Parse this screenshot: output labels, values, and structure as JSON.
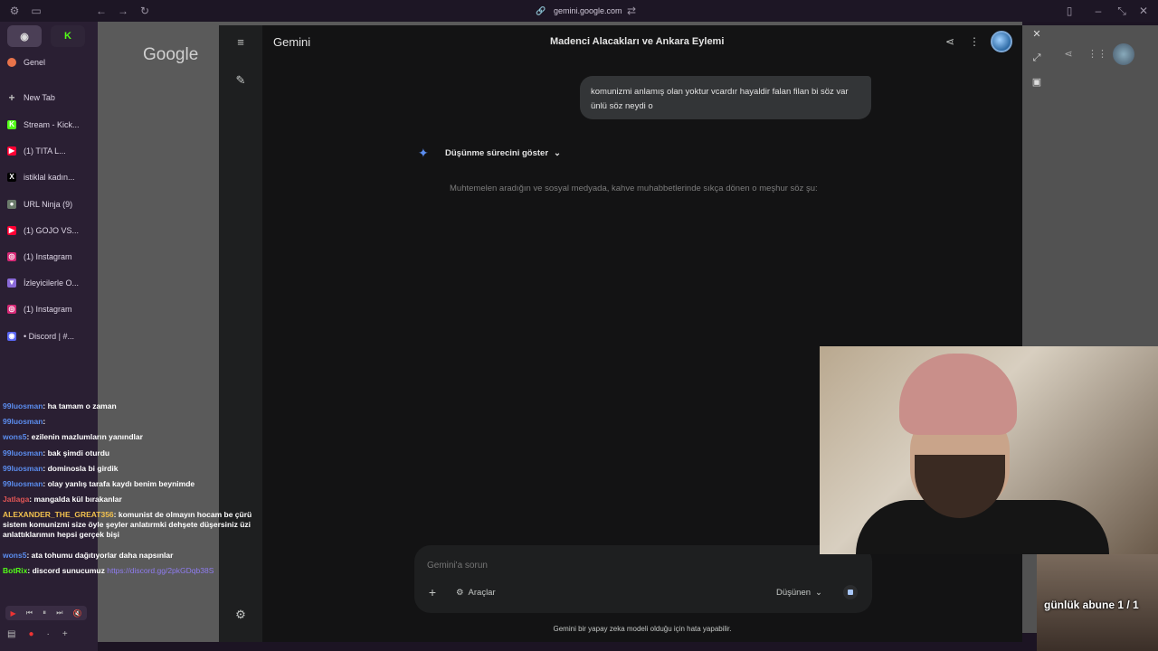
{
  "browser": {
    "url": "gemini.google.com"
  },
  "vertical_tabs": {
    "section_label": "Genel",
    "new_tab_label": "New Tab",
    "tabs": [
      {
        "label": "Stream - Kick...",
        "color": "#53fc18",
        "glyph": "K"
      },
      {
        "label": "(1) TITA L...",
        "color": "#ff0033",
        "glyph": "▶"
      },
      {
        "label": "istiklal kadın...",
        "color": "#000000",
        "glyph": "X"
      },
      {
        "label": "URL Ninja (9)",
        "color": "#6b7b6b",
        "glyph": "●"
      },
      {
        "label": "(1) GOJO VS...",
        "color": "#ff0033",
        "glyph": "▶"
      },
      {
        "label": "(1) Instagram",
        "color": "#d62976",
        "glyph": "◎"
      },
      {
        "label": "İzleyicilerle O...",
        "color": "#8a6ad8",
        "glyph": "▼"
      },
      {
        "label": "(1) Instagram",
        "color": "#d62976",
        "glyph": "◎"
      },
      {
        "label": "• Discord | #...",
        "color": "#5865f2",
        "glyph": "◉"
      }
    ]
  },
  "chat": {
    "messages": [
      {
        "user": "99luosman",
        "user_color": "#5b8def",
        "text": ": ha tamam o zaman"
      },
      {
        "user": "99luosman",
        "user_color": "#5b8def",
        "text": ": "
      },
      {
        "user": "wons5",
        "user_color": "#5b8def",
        "text": ": ezilenin mazlumların yanındlar"
      },
      {
        "user": "99luosman",
        "user_color": "#5b8def",
        "text": ": bak şimdi oturdu"
      },
      {
        "user": "99luosman",
        "user_color": "#5b8def",
        "text": ": dominosla bi girdik"
      },
      {
        "user": "99luosman",
        "user_color": "#5b8def",
        "text": ": olay yanlış tarafa kaydı benim beynimde"
      },
      {
        "user": "Jatlaga",
        "user_color": "#e05555",
        "text": ": mangalda kül bırakanlar"
      },
      {
        "user": "ALEXANDER_THE_GREAT356",
        "user_color": "#f2c14e",
        "text": ": komunist de olmayın hocam be çürü sistem komunizmi size öyle şeyler anlatırmki dehşete düşersiniz üzi anlattıklarımın hepsi gerçek bişi"
      },
      {
        "user": "wons5",
        "user_color": "#5b8def",
        "text": ": ata tohumu dağıtıyorlar daha napsınlar"
      },
      {
        "user": "BotRix",
        "user_color": "#53fc18",
        "text": ": discord sunucumuz ",
        "link": "https://discord.gg/2pkGDqb38S"
      }
    ]
  },
  "google_page": {
    "logo": "Google"
  },
  "gemini": {
    "brand": "Gemini",
    "conversation_title": "Madenci Alacakları ve Ankara Eylemi",
    "user_message": "komunizmi anlamış olan yoktur vcardır hayaldir falan filan bi söz var ünlü söz neydi o",
    "thinking_toggle": "Düşünme sürecini göster",
    "response_partial": "Muhtemelen aradığın ve sosyal medyada, kahve muhabbetlerinde sıkça dönen o meşhur söz şu:",
    "composer": {
      "placeholder": "Gemini'a sorun",
      "tools_label": "Araçlar",
      "mode_label": "Düşünen"
    },
    "disclaimer": "Gemini bir yapay zeka modeli olduğu için hata yapabilir.",
    "accent": "#a8c7fa"
  },
  "stream_overlay": {
    "sub_goal": "günlük abune 1 / 1"
  }
}
